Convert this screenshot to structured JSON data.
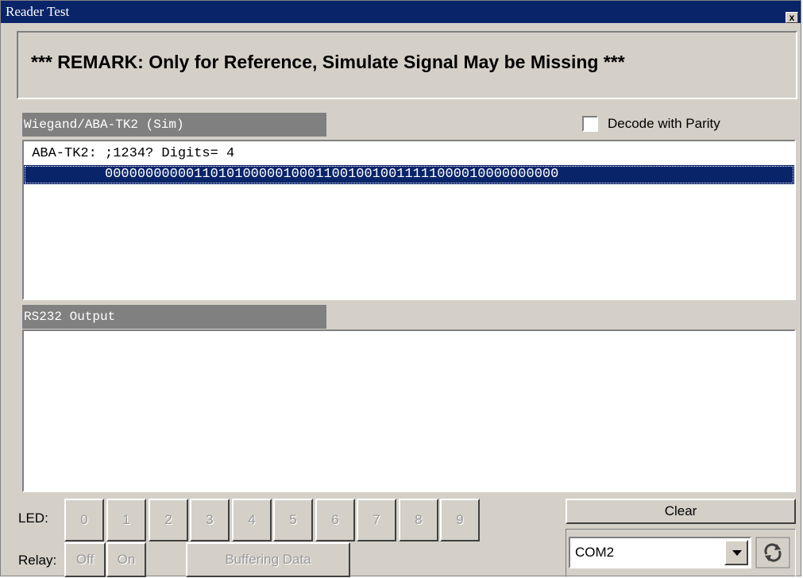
{
  "window": {
    "title": "Reader Test",
    "close_label": "x"
  },
  "remark": "*** REMARK: Only for Reference, Simulate Signal May be Missing ***",
  "wiegand": {
    "header": "Wiegand/ABA-TK2 (Sim)",
    "decode_label": "Decode with Parity",
    "decode_checked": false,
    "lines": [
      " ABA-TK2: ;1234? Digits= 4",
      "          00000000000110101000001000110010010011111000010000000000"
    ],
    "selected_index": 1
  },
  "rs232": {
    "header": "RS232 Output",
    "lines": []
  },
  "led": {
    "label": "LED:",
    "buttons": [
      "0",
      "1",
      "2",
      "3",
      "4",
      "5",
      "6",
      "7",
      "8",
      "9"
    ]
  },
  "relay": {
    "label": "Relay:",
    "off": "Off",
    "on": "On"
  },
  "buffering_label": "Buffering Data",
  "clear_label": "Clear",
  "port": {
    "selected": "COM2"
  },
  "colors": {
    "title_bg": "#0a246a",
    "face": "#d4d0c8",
    "header_bg": "#808080",
    "selection": "#0a246a"
  },
  "icons": {
    "refresh": "refresh-icon",
    "close": "close-icon",
    "dropdown": "chevron-down-icon"
  }
}
